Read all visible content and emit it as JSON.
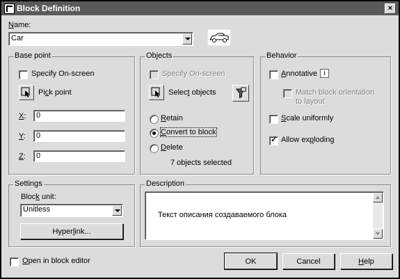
{
  "window": {
    "title": "Block Definition",
    "close": "×"
  },
  "name": {
    "label_pre": "",
    "label_hot": "N",
    "label_post": "ame:",
    "value": "Car",
    "preview_icon": "car-icon"
  },
  "base_point": {
    "title": "Base point",
    "specify_onscreen": "Specify On-screen",
    "pick_point_pre": "Pi",
    "pick_point_hot": "c",
    "pick_point_post": "k point",
    "x_hot": "X",
    "y_hot": "Y",
    "z_hot": "Z",
    "colon": ":",
    "x": "0",
    "y": "0",
    "z": "0"
  },
  "objects": {
    "title": "Objects",
    "specify_onscreen": "Specify On-screen",
    "select_pre": "Selec",
    "select_hot": "t",
    "select_post": " objects",
    "retain_hot": "R",
    "retain_post": "etain",
    "convert_hot": "C",
    "convert_post": "onvert to block",
    "delete_hot": "D",
    "delete_post": "elete",
    "selected_count": "7 objects selected",
    "quick_select_icon": "quick-select-filter-icon"
  },
  "behavior": {
    "title": "Behavior",
    "annotative_hot": "A",
    "annotative_post": "nnotative",
    "match_line1": "Match block orientation",
    "match_line2": "to layout",
    "scale_hot": "S",
    "scale_post": "cale uniformly",
    "allow_pre": "Allow ex",
    "allow_hot": "p",
    "allow_post": "loding",
    "info_glyph": "i"
  },
  "settings": {
    "title": "Settings",
    "block_unit_pre": "Bloc",
    "block_unit_hot": "k",
    "block_unit_post": " unit:",
    "block_unit_value": "Unitless",
    "hyperlink_pre": "Hyper",
    "hyperlink_hot": "l",
    "hyperlink_post": "ink..."
  },
  "description": {
    "title": "Description",
    "text": "Текст описания создаваемого блока"
  },
  "footer": {
    "open_editor_hot": "O",
    "open_editor_post": "pen in block editor",
    "ok": "OK",
    "cancel": "Cancel",
    "help_hot": "H",
    "help_post": "elp"
  },
  "state": {
    "specify_base_onscreen": false,
    "specify_objects_onscreen": false,
    "annotative": false,
    "match_orientation": false,
    "scale_uniformly": false,
    "allow_exploding": true,
    "open_in_editor": false,
    "object_mode": "convert"
  },
  "colors": {
    "dialog_bg": "#dcdcdc",
    "titlebar": "#5a5a5a",
    "field_bg": "#ffffff"
  }
}
